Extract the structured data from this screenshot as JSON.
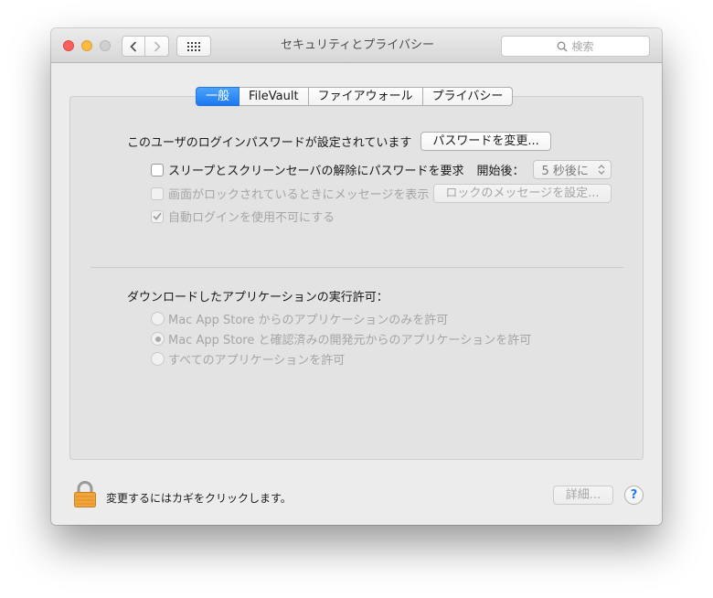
{
  "window": {
    "title": "セキュリティとプライバシー",
    "search_placeholder": "検索"
  },
  "tabs": [
    {
      "label": "一般",
      "active": true
    },
    {
      "label": "FileVault",
      "active": false
    },
    {
      "label": "ファイアウォール",
      "active": false
    },
    {
      "label": "プライバシー",
      "active": false
    }
  ],
  "general": {
    "password_set_label": "このユーザのログインパスワードが設定されています",
    "change_password_button": "パスワードを変更...",
    "require_password": {
      "label": "スリープとスクリーンセーバの解除にパスワードを要求",
      "checked": false,
      "after_label": "開始後：",
      "delay_value": "5 秒後に"
    },
    "lock_message": {
      "label": "画面がロックされているときにメッセージを表示",
      "checked": false,
      "button": "ロックのメッセージを設定..."
    },
    "disable_autologin": {
      "label": "自動ログインを使用不可にする",
      "checked": true
    },
    "downloads_heading": "ダウンロードしたアプリケーションの実行許可：",
    "download_options": [
      {
        "label": "Mac App Store からのアプリケーションのみを許可",
        "selected": false
      },
      {
        "label": "Mac App Store と確認済みの開発元からのアプリケーションを許可",
        "selected": true
      },
      {
        "label": "すべてのアプリケーションを許可",
        "selected": false
      }
    ]
  },
  "footer": {
    "lock_text": "変更するにはカギをクリックします。",
    "details_button": "詳細...",
    "help_symbol": "?"
  },
  "colors": {
    "accent": "#1d78f1",
    "close": "#fc605c",
    "minimize": "#fdbc40",
    "lock": "#f0a53d"
  },
  "icons": [
    "chevron-left-icon",
    "chevron-right-icon",
    "grid-icon",
    "search-icon",
    "lock-icon",
    "stepper-icon",
    "checkmark-icon"
  ]
}
